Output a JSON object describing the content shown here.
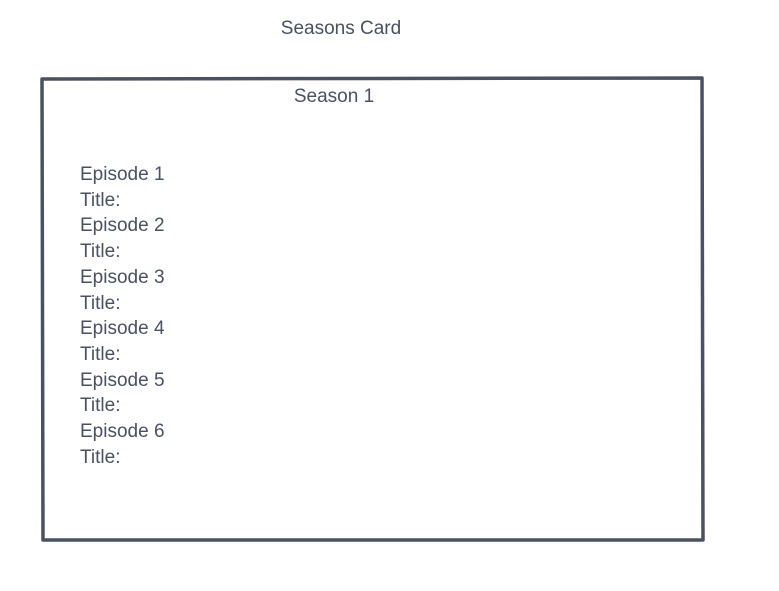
{
  "page": {
    "title": "Seasons Card"
  },
  "card": {
    "season_title": "Season 1",
    "border_color": "#4a5160",
    "lines": [
      "Episode 1",
      "Title:",
      "Episode 2",
      "Title:",
      "Episode 3",
      "Title:",
      "Episode 4",
      "Title:",
      "Episode 5",
      "Title:",
      "Episode 6",
      "Title:"
    ]
  }
}
